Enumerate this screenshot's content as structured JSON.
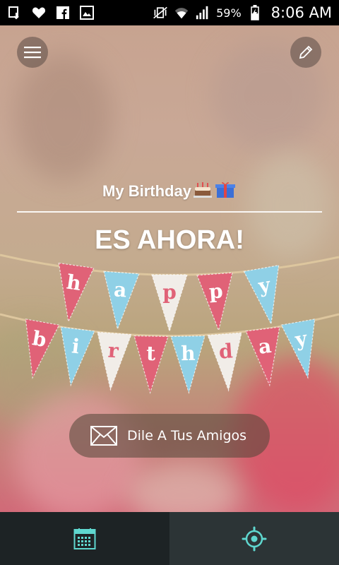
{
  "status_bar": {
    "icons_left": [
      "download-icon",
      "heart-icon",
      "facebook-icon",
      "image-icon"
    ],
    "icons_right": [
      "vibrate-mute-icon",
      "wifi-icon",
      "signal-icon",
      "battery-icon"
    ],
    "battery": "59%",
    "time": "8:06 AM"
  },
  "header": {
    "menu_icon": "hamburger-menu-icon",
    "edit_icon": "pencil-icon"
  },
  "content": {
    "title": "My Birthday",
    "title_emoji": "🎂🎁",
    "headline": "ES AHORA!",
    "bunting_row1": [
      "h",
      "a",
      "p",
      "p",
      "y"
    ],
    "bunting_row2": [
      "b",
      "i",
      "r",
      "t",
      "h",
      "d",
      "a",
      "y"
    ]
  },
  "share": {
    "icon": "envelope-icon",
    "label": "Dile A Tus Amigos"
  },
  "bottom_nav": {
    "tabs": [
      {
        "name": "calendar-tab",
        "icon": "calendar-icon",
        "active": true
      },
      {
        "name": "settings-tab",
        "icon": "gear-icon",
        "active": false
      }
    ]
  },
  "colors": {
    "accent": "#5fd7cf",
    "flag_pink": "#e06277",
    "flag_blue": "#8fd0e6",
    "flag_white": "#f1ede8",
    "nav_dark": "#1d2325",
    "nav_light": "#2c3436"
  }
}
